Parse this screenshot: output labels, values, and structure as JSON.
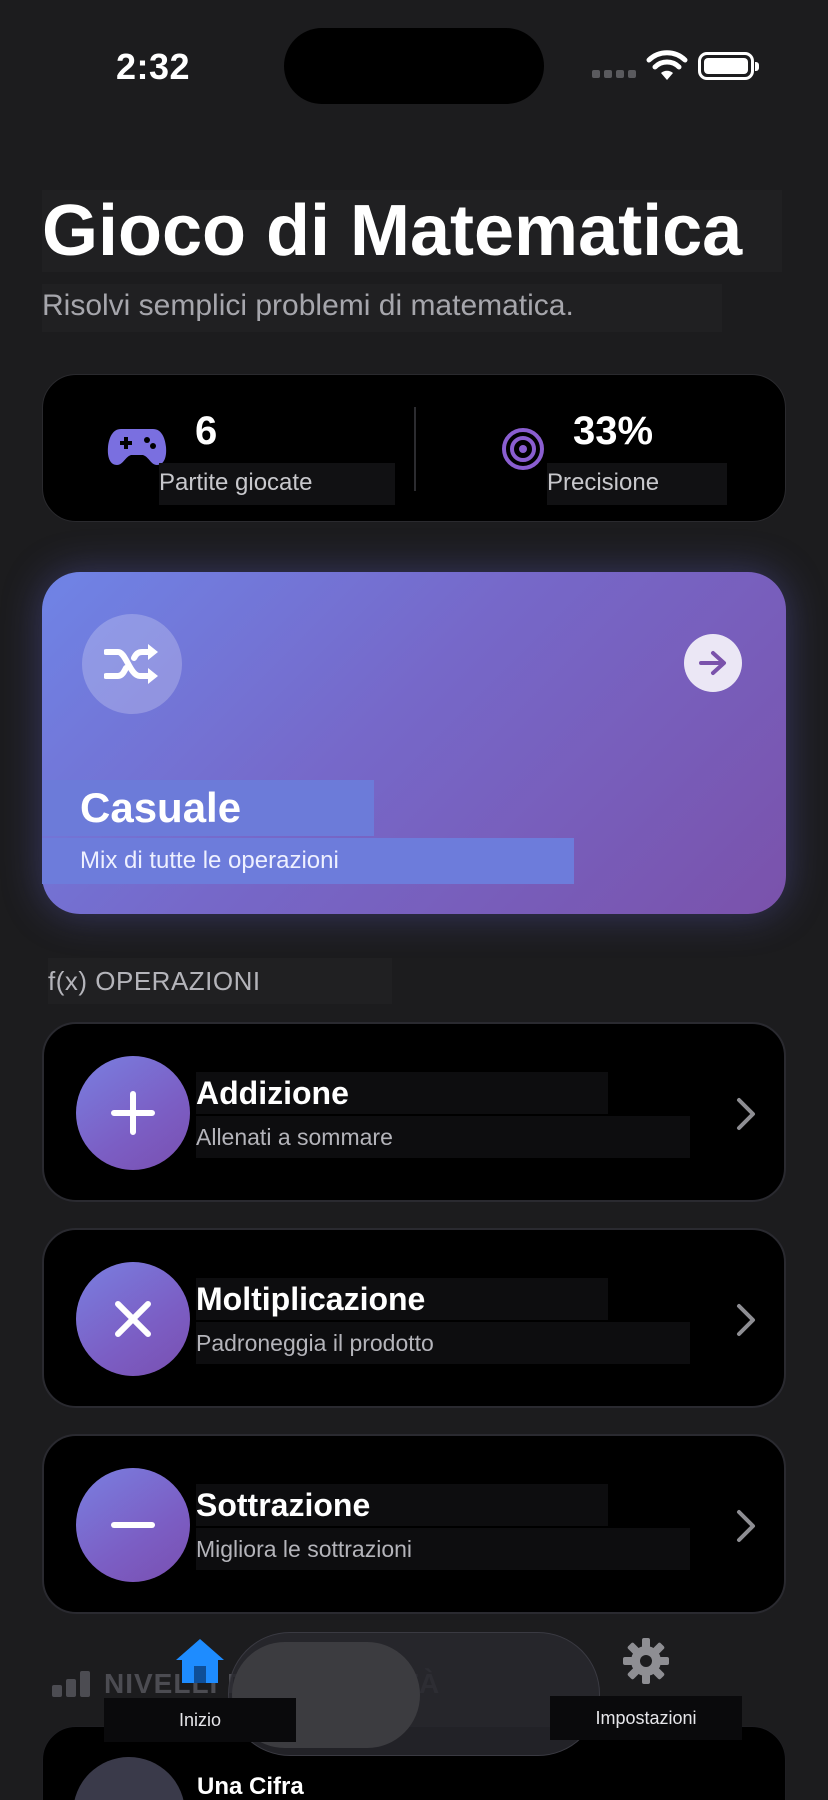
{
  "status_bar": {
    "time": "2:32"
  },
  "header": {
    "title": "Gioco di Matematica",
    "subtitle": "Risolvi semplici problemi di matematica."
  },
  "stats": {
    "games_played_value": "6",
    "games_played_label": "Partite giocate",
    "accuracy_value": "33%",
    "accuracy_label": "Precisione"
  },
  "random_card": {
    "title": "Casuale",
    "subtitle": "Mix di tutte le operazioni"
  },
  "operations_section": {
    "header": "f(x) OPERAZIONI",
    "items": [
      {
        "title": "Addizione",
        "subtitle": "Allenati a sommare",
        "icon": "plus-icon"
      },
      {
        "title": "Moltiplicazione",
        "subtitle": "Padroneggia il prodotto",
        "icon": "multiply-icon"
      },
      {
        "title": "Sottrazione",
        "subtitle": "Migliora le sottrazioni",
        "icon": "minus-icon"
      }
    ]
  },
  "levels_section": {
    "header": "NIVELLI DI DIFFICOLTÀ",
    "first_level": "Una Cifra"
  },
  "tabbar": {
    "home_label": "Inizio",
    "settings_label": "Impostazioni"
  },
  "colors": {
    "background": "#1c1c1e",
    "card": "#000000",
    "accent_gradient_start": "#6f84e6",
    "accent_gradient_end": "#7a52ab",
    "stat_icon": "#7a6fe0",
    "tab_active": "#1e8cff"
  }
}
